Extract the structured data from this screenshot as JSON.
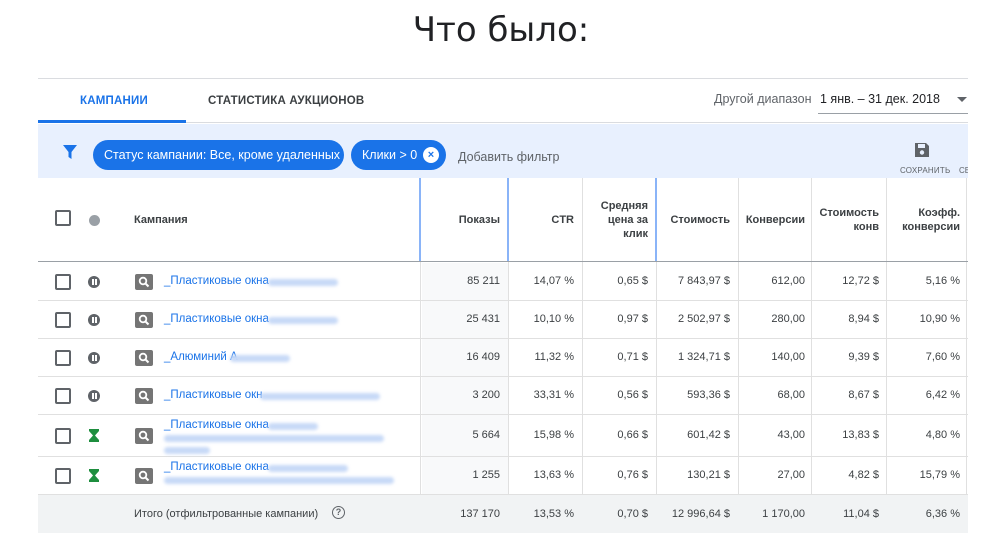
{
  "heading": "Что было:",
  "tabs": [
    {
      "label": "КАМПАНИИ",
      "active": true
    },
    {
      "label": "СТАТИСТИКА АУКЦИОНОВ",
      "active": false
    }
  ],
  "date_range": {
    "label": "Другой диапазон",
    "value": "1 янв. – 31 дек. 2018"
  },
  "filters": {
    "chips": [
      "Статус кампании: Все, кроме удаленных",
      "Клики > 0"
    ],
    "add_label": "Добавить фильтр",
    "save_label": "СОХРАНИТЬ",
    "next_label": "СБ"
  },
  "table": {
    "headers": {
      "campaign": "Кампания",
      "impressions": "Показы",
      "ctr": "CTR",
      "avg_cpc": [
        "Средняя",
        "цена за",
        "клик"
      ],
      "cost": "Стоимость",
      "conversions": "Конверсии",
      "cost_per_conv": [
        "Стоимость",
        "конв"
      ],
      "conv_rate": [
        "Коэфф.",
        "конверсии"
      ]
    },
    "rows": [
      {
        "status": "paused",
        "name": "_Пластиковые окна",
        "impressions": "85 211",
        "ctr": "14,07 %",
        "avg_cpc": "0,65 $",
        "cost": "7 843,97 $",
        "conversions": "612,00",
        "cost_per_conv": "12,72 $",
        "conv_rate": "5,16 %"
      },
      {
        "status": "paused",
        "name": "_Пластиковые окна",
        "impressions": "25 431",
        "ctr": "10,10 %",
        "avg_cpc": "0,97 $",
        "cost": "2 502,97 $",
        "conversions": "280,00",
        "cost_per_conv": "8,94 $",
        "conv_rate": "10,90 %"
      },
      {
        "status": "paused",
        "name": "_Алюминий А",
        "impressions": "16 409",
        "ctr": "11,32 %",
        "avg_cpc": "0,71 $",
        "cost": "1 324,71 $",
        "conversions": "140,00",
        "cost_per_conv": "9,39 $",
        "conv_rate": "7,60 %"
      },
      {
        "status": "paused",
        "name": "_Пластиковые окн",
        "impressions": "3 200",
        "ctr": "33,31 %",
        "avg_cpc": "0,56 $",
        "cost": "593,36 $",
        "conversions": "68,00",
        "cost_per_conv": "8,67 $",
        "conv_rate": "6,42 %"
      },
      {
        "status": "limited",
        "name": "_Пластиковые окна",
        "impressions": "5 664",
        "ctr": "15,98 %",
        "avg_cpc": "0,66 $",
        "cost": "601,42 $",
        "conversions": "43,00",
        "cost_per_conv": "13,83 $",
        "conv_rate": "4,80 %"
      },
      {
        "status": "limited",
        "name": "_Пластиковые окна",
        "impressions": "1 255",
        "ctr": "13,63 %",
        "avg_cpc": "0,76 $",
        "cost": "130,21 $",
        "conversions": "27,00",
        "cost_per_conv": "4,82 $",
        "conv_rate": "15,79 %"
      }
    ],
    "total": {
      "label": "Итого (отфильтрованные кампании)",
      "impressions": "137 170",
      "ctr": "13,53 %",
      "avg_cpc": "0,70 $",
      "cost": "12 996,64 $",
      "conversions": "1 170,00",
      "cost_per_conv": "11,04 $",
      "conv_rate": "6,36 %"
    }
  },
  "colors": {
    "accent": "#1a73e8",
    "filter_bg": "#e8f0fe",
    "limited_green": "#1e8e3e",
    "paused_grey": "#5f6368"
  }
}
